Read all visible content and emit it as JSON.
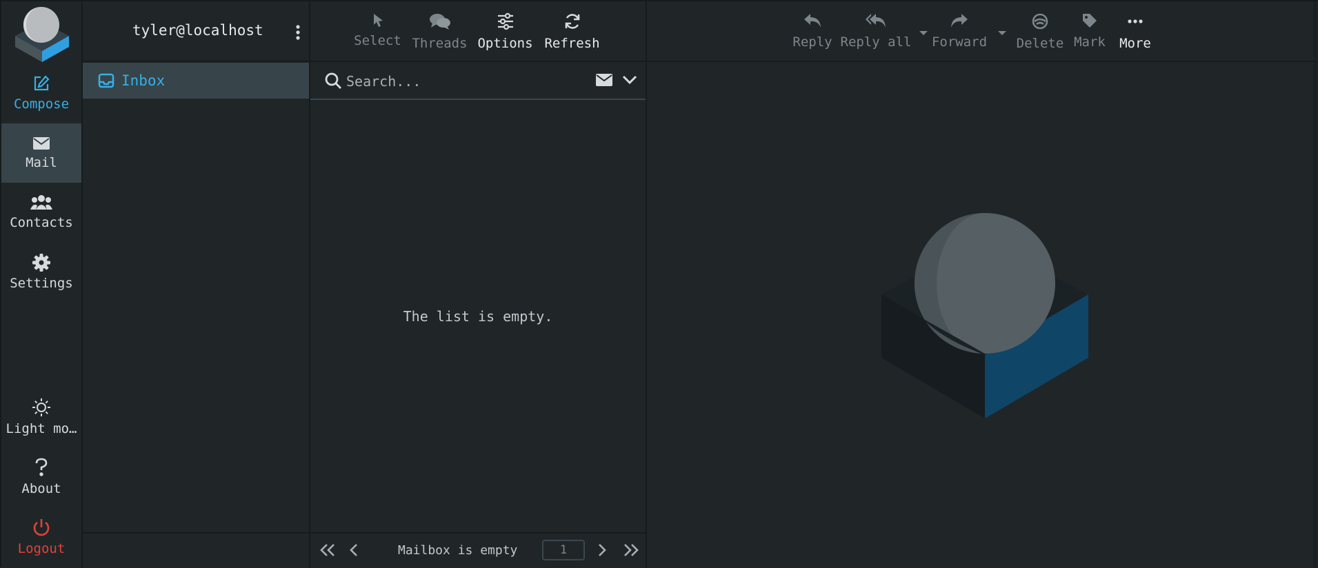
{
  "nav": {
    "compose": "Compose",
    "mail": "Mail",
    "contacts": "Contacts",
    "settings": "Settings",
    "light_mode": "Light mo…",
    "about": "About",
    "logout": "Logout"
  },
  "account": {
    "name": "tyler@localhost"
  },
  "folders": [
    {
      "label": "Inbox",
      "icon": "inbox-icon",
      "selected": true
    }
  ],
  "list_toolbar": {
    "select": "Select",
    "threads": "Threads",
    "options": "Options",
    "refresh": "Refresh"
  },
  "search": {
    "placeholder": "Search..."
  },
  "list": {
    "empty_message": "The list is empty."
  },
  "pager": {
    "status": "Mailbox is empty",
    "page": "1"
  },
  "message_toolbar": {
    "reply": "Reply",
    "reply_all": "Reply all",
    "forward": "Forward",
    "delete": "Delete",
    "mark": "Mark",
    "more": "More"
  },
  "colors": {
    "background": "#202628",
    "accent": "#37b0e6",
    "selected_bg": "#37444a",
    "logout": "#e0423c",
    "disabled_text": "#7d868a"
  }
}
